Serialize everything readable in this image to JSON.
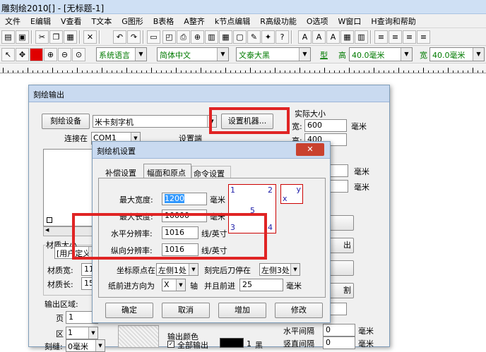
{
  "window": {
    "title": "雕刻绘2010[] - [无标题-1]"
  },
  "menu": [
    "文件",
    "E编辑",
    "V查看",
    "T文本",
    "G图形",
    "B表格",
    "A整齐",
    "k节点编辑",
    "R高级功能",
    "O选项",
    "W窗口",
    "H查询和帮助"
  ],
  "toolbar2": {
    "lang": "系统语言",
    "font": "简体中文",
    "font_name": "文泰大黑",
    "type_icon": "型",
    "height_label": "高",
    "height_value": "40.0毫米",
    "width_label": "宽",
    "width_value": "40.0毫米"
  },
  "outer": {
    "title": "刻绘输出",
    "device_btn": "刻绘设备",
    "device": "米卡刻字机",
    "setup_btn": "设置机器...",
    "connect_label": "连接在",
    "port": "COM1",
    "port_setup": "设置端",
    "actual_size": "实际大小",
    "width_label": "宽:",
    "width_value": "600",
    "height_label": "高:",
    "height_value": "400",
    "unit": "毫米",
    "unit2": "毫米",
    "unit3": "毫米",
    "unit4": "毫米",
    "material_size": "材质大小",
    "user_def": "[用户定义",
    "mat_width": "材质宽:",
    "mat_width_v": "118",
    "mat_len": "材质长:",
    "mat_len_v": "150",
    "output_area": "输出区域:",
    "page_label": "页",
    "page_value": "1",
    "area_label": "区",
    "area_value": "1",
    "margin_label": "刻缝:",
    "margin_value": "0毫米",
    "output_color": "输出颜色",
    "all_output": "全部输出",
    "color_num": "1",
    "color_name": "黑",
    "h_gap": "水平间隔",
    "v_gap": "竖直间隔",
    "gap1": "0",
    "gap2": "0",
    "right_btn": "出",
    "cut_btn": "割",
    "out_btn": "出"
  },
  "inner": {
    "title": "刻绘机设置",
    "close": "✕",
    "tabs": [
      "补偿设置",
      "幅面和原点",
      "命令设置"
    ],
    "max_width_label": "最大宽度:",
    "max_width": "1200",
    "max_len_label": "最大长度:",
    "max_len": "10000",
    "unit_mm": "毫米",
    "unit_mm2": "毫米",
    "h_res_label": "水平分辨率:",
    "h_res": "1016",
    "v_res_label": "纵向分辨率:",
    "v_res": "1016",
    "res_unit": "线/英寸",
    "res_unit2": "线/英寸",
    "corner_labels": [
      "1",
      "2",
      "3",
      "4",
      "5"
    ],
    "axis_y": "y",
    "axis_x": "x",
    "origin_label": "坐标原点在",
    "origin_value": "左侧1处",
    "after_label": "刻完后刀停在",
    "after_value": "左侧3处",
    "feed_label": "纸前进方向为",
    "feed_value": "X",
    "axis_suffix": "轴",
    "advance_label": "并且前进",
    "advance_value": "25",
    "advance_unit": "毫米",
    "ok": "确定",
    "cancel": "取消",
    "add": "增加",
    "modify": "修改"
  }
}
